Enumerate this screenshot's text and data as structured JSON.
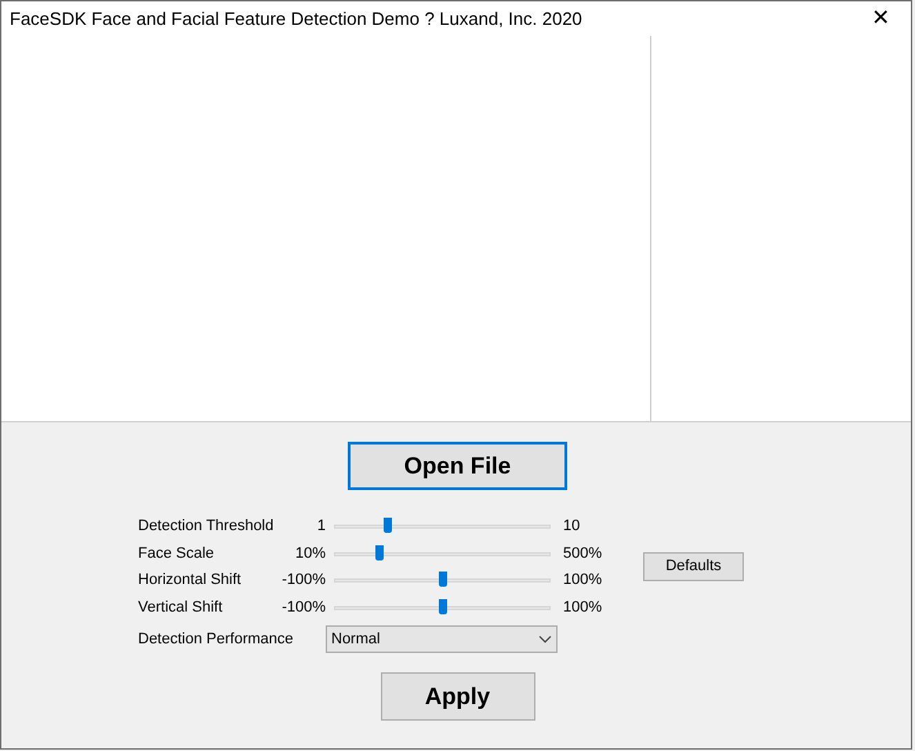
{
  "window": {
    "title": "FaceSDK Face and Facial Feature Detection Demo ? Luxand, Inc. 2020",
    "close": "✕"
  },
  "open_button": "Open File",
  "sliders": [
    {
      "label": "Detection Threshold",
      "min": "1",
      "max": "10",
      "level": 0.24
    },
    {
      "label": "Face Scale",
      "min": "10%",
      "max": "500%",
      "level": 0.2
    },
    {
      "label": "Horizontal Shift",
      "min": "-100%",
      "max": "100%",
      "level": 0.5
    },
    {
      "label": "Vertical Shift",
      "min": "-100%",
      "max": "100%",
      "level": 0.5
    }
  ],
  "defaults_button": "Defaults",
  "performance": {
    "label": "Detection Performance",
    "value": "Normal"
  },
  "apply_button": "Apply"
}
